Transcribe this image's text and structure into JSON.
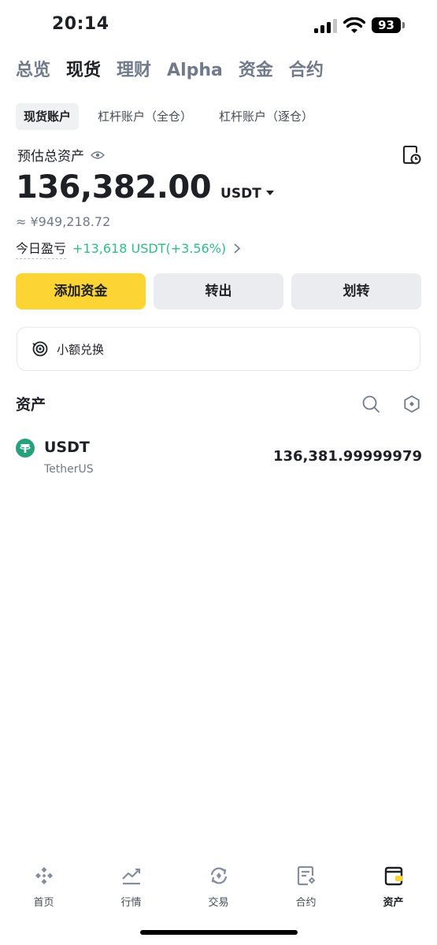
{
  "status_bar": {
    "time": "20:14",
    "battery": "93"
  },
  "top_tabs": [
    {
      "label": "总览",
      "active": false
    },
    {
      "label": "现货",
      "active": true
    },
    {
      "label": "理财",
      "active": false
    },
    {
      "label": "Alpha",
      "active": false
    },
    {
      "label": "资金",
      "active": false
    },
    {
      "label": "合约",
      "active": false
    }
  ],
  "account_tabs": [
    {
      "label": "现货账户",
      "active": true
    },
    {
      "label": "杠杆账户（全仓）",
      "active": false
    },
    {
      "label": "杠杆账户（逐仓）",
      "active": false
    }
  ],
  "balance": {
    "label": "预估总资产",
    "value": "136,382.00",
    "unit": "USDT",
    "fiat_equivalent": "≈ ¥949,218.72",
    "pnl_label": "今日盈亏",
    "pnl_value": "+13,618 USDT(+3.56%)"
  },
  "actions": {
    "add_funds": "添加资金",
    "withdraw": "转出",
    "transfer": "划转"
  },
  "dust_convert": {
    "label": "小额兑换"
  },
  "assets": {
    "title": "资产",
    "items": [
      {
        "symbol": "USDT",
        "name": "TetherUS",
        "amount": "136,381.99999979"
      }
    ]
  },
  "bottom_nav": [
    {
      "label": "首页",
      "icon": "binance-logo-icon",
      "active": false
    },
    {
      "label": "行情",
      "icon": "chart-icon",
      "active": false
    },
    {
      "label": "交易",
      "icon": "trade-icon",
      "active": false
    },
    {
      "label": "合约",
      "icon": "futures-icon",
      "active": false
    },
    {
      "label": "资产",
      "icon": "wallet-icon",
      "active": true
    }
  ],
  "colors": {
    "brand_yellow": "#fcd535",
    "positive_green": "#2ebd85",
    "tether_green": "#26a17b"
  }
}
